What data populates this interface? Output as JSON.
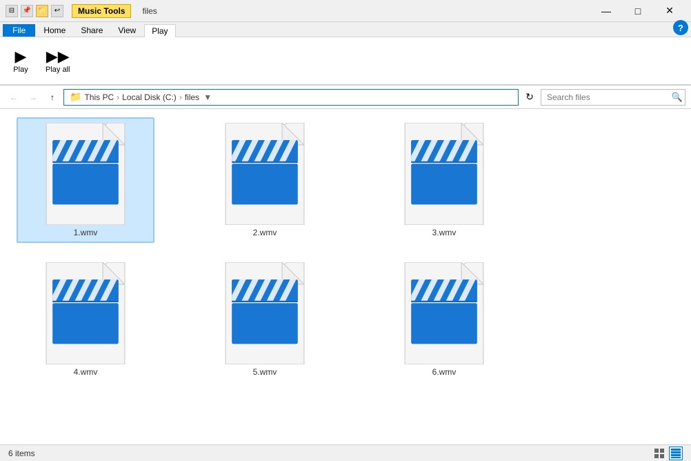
{
  "titleBar": {
    "appName": "files",
    "musicToolsTab": "Music Tools",
    "minimize": "—",
    "maximize": "□",
    "close": "✕"
  },
  "ribbon": {
    "tabs": [
      "File",
      "Home",
      "Share",
      "View",
      "Play"
    ],
    "activeTab": "Music Tools",
    "playTab": "Play"
  },
  "addressBar": {
    "pathParts": [
      "This PC",
      "Local Disk (C:)",
      "files"
    ],
    "searchPlaceholder": "Search files",
    "searchLabel": "Search"
  },
  "files": [
    {
      "name": "1.wmv",
      "selected": true
    },
    {
      "name": "2.wmv",
      "selected": false
    },
    {
      "name": "3.wmv",
      "selected": false
    },
    {
      "name": "4.wmv",
      "selected": false
    },
    {
      "name": "5.wmv",
      "selected": false
    },
    {
      "name": "6.wmv",
      "selected": false
    }
  ],
  "statusBar": {
    "itemCount": "6 items"
  },
  "colors": {
    "clapperBlue": "#1e88e5",
    "clapperDark": "#1565c0",
    "accent": "#0078d7",
    "selectedBg": "#cde8ff",
    "selectedBorder": "#90c8f0"
  }
}
